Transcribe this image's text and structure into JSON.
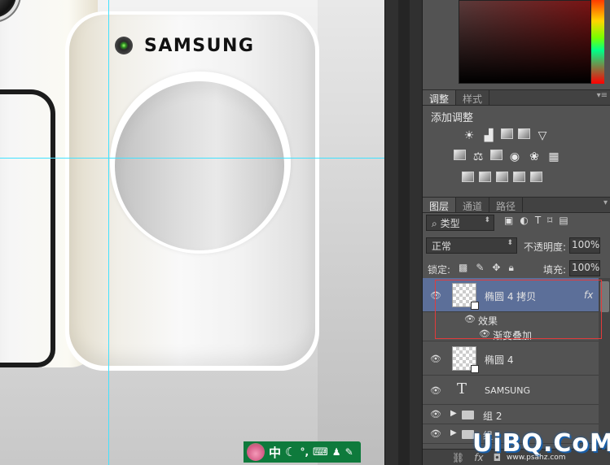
{
  "canvas": {
    "brand_text": "SAMSUNG"
  },
  "ime": {
    "label": "中",
    "moon": "☾",
    "punct": "°,",
    "keyboard": "⌨",
    "person": "♟",
    "tool": "🔧"
  },
  "adjust_panel": {
    "tabs": [
      "调整",
      "样式"
    ],
    "title": "添加调整",
    "menu_icon": "▾≡"
  },
  "layers_panel": {
    "tabs": [
      "图层",
      "通道",
      "路径"
    ],
    "filter_type": "类型",
    "filter_search_icon": "⌕",
    "blend_mode": "正常",
    "opacity_label": "不透明度:",
    "opacity_value": "100%",
    "lock_label": "锁定:",
    "fill_label": "填充:",
    "fill_value": "100%",
    "filter_glyph_text": "T",
    "layers": [
      {
        "name": "椭圆 4 拷贝",
        "fx": "fx",
        "selected": true
      },
      {
        "name": "效果"
      },
      {
        "name": "渐变叠加"
      },
      {
        "name": "椭圆 4"
      },
      {
        "name": "SAMSUNG",
        "type_glyph": "T"
      },
      {
        "name": "组 2"
      },
      {
        "name": "组"
      }
    ]
  },
  "watermark": {
    "text": "UiBQ.CoM",
    "sub": "www.psahz.com"
  }
}
